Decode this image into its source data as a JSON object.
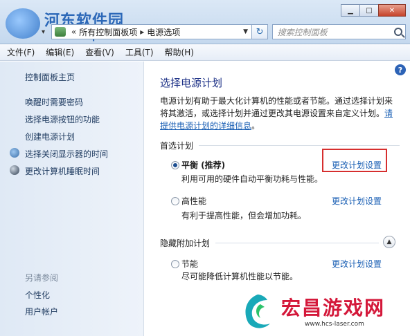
{
  "watermark": {
    "title": "河东软件园",
    "url": "www.pc0359.cn"
  },
  "window": {
    "min": "▁",
    "max": "□",
    "close": "✕"
  },
  "address": {
    "crumb_root": "所有控制面板项",
    "crumb_current": "电源选项"
  },
  "search": {
    "placeholder": "搜索控制面板"
  },
  "menu": [
    "文件(F)",
    "编辑(E)",
    "查看(V)",
    "工具(T)",
    "帮助(H)"
  ],
  "sidebar": {
    "home": "控制面板主页",
    "items": [
      "唤醒时需要密码",
      "选择电源按钮的功能",
      "创建电源计划",
      "选择关闭显示器的时间",
      "更改计算机睡眠时间"
    ],
    "see_also_heading": "另请参阅",
    "see_also": [
      "个性化",
      "用户帐户"
    ]
  },
  "main": {
    "title": "选择电源计划",
    "desc": "电源计划有助于最大化计算机的性能或者节能。通过选择计划来将其激活，或选择计划并通过更改其电源设置来自定义计划。",
    "desc_link": "请提供电源计划的详细信息",
    "desc_end": "。",
    "preferred_heading": "首选计划",
    "hidden_heading": "隐藏附加计划",
    "plans": [
      {
        "name": "平衡 (推荐)",
        "desc": "利用可用的硬件自动平衡功耗与性能。",
        "link": "更改计划设置",
        "selected": true
      },
      {
        "name": "高性能",
        "desc": "有利于提高性能，但会增加功耗。",
        "link": "更改计划设置",
        "selected": false
      },
      {
        "name": "节能",
        "desc": "尽可能降低计算机性能以节能。",
        "link": "更改计划设置",
        "selected": false
      }
    ]
  },
  "bottom_watermark": {
    "title": "宏昌游戏网",
    "url": "www.hcs-laser.com"
  },
  "colors": {
    "accent": "#1e3287",
    "link": "#1a5fb4",
    "highlight": "#d62e2e",
    "watermark_red": "#d4183a"
  }
}
